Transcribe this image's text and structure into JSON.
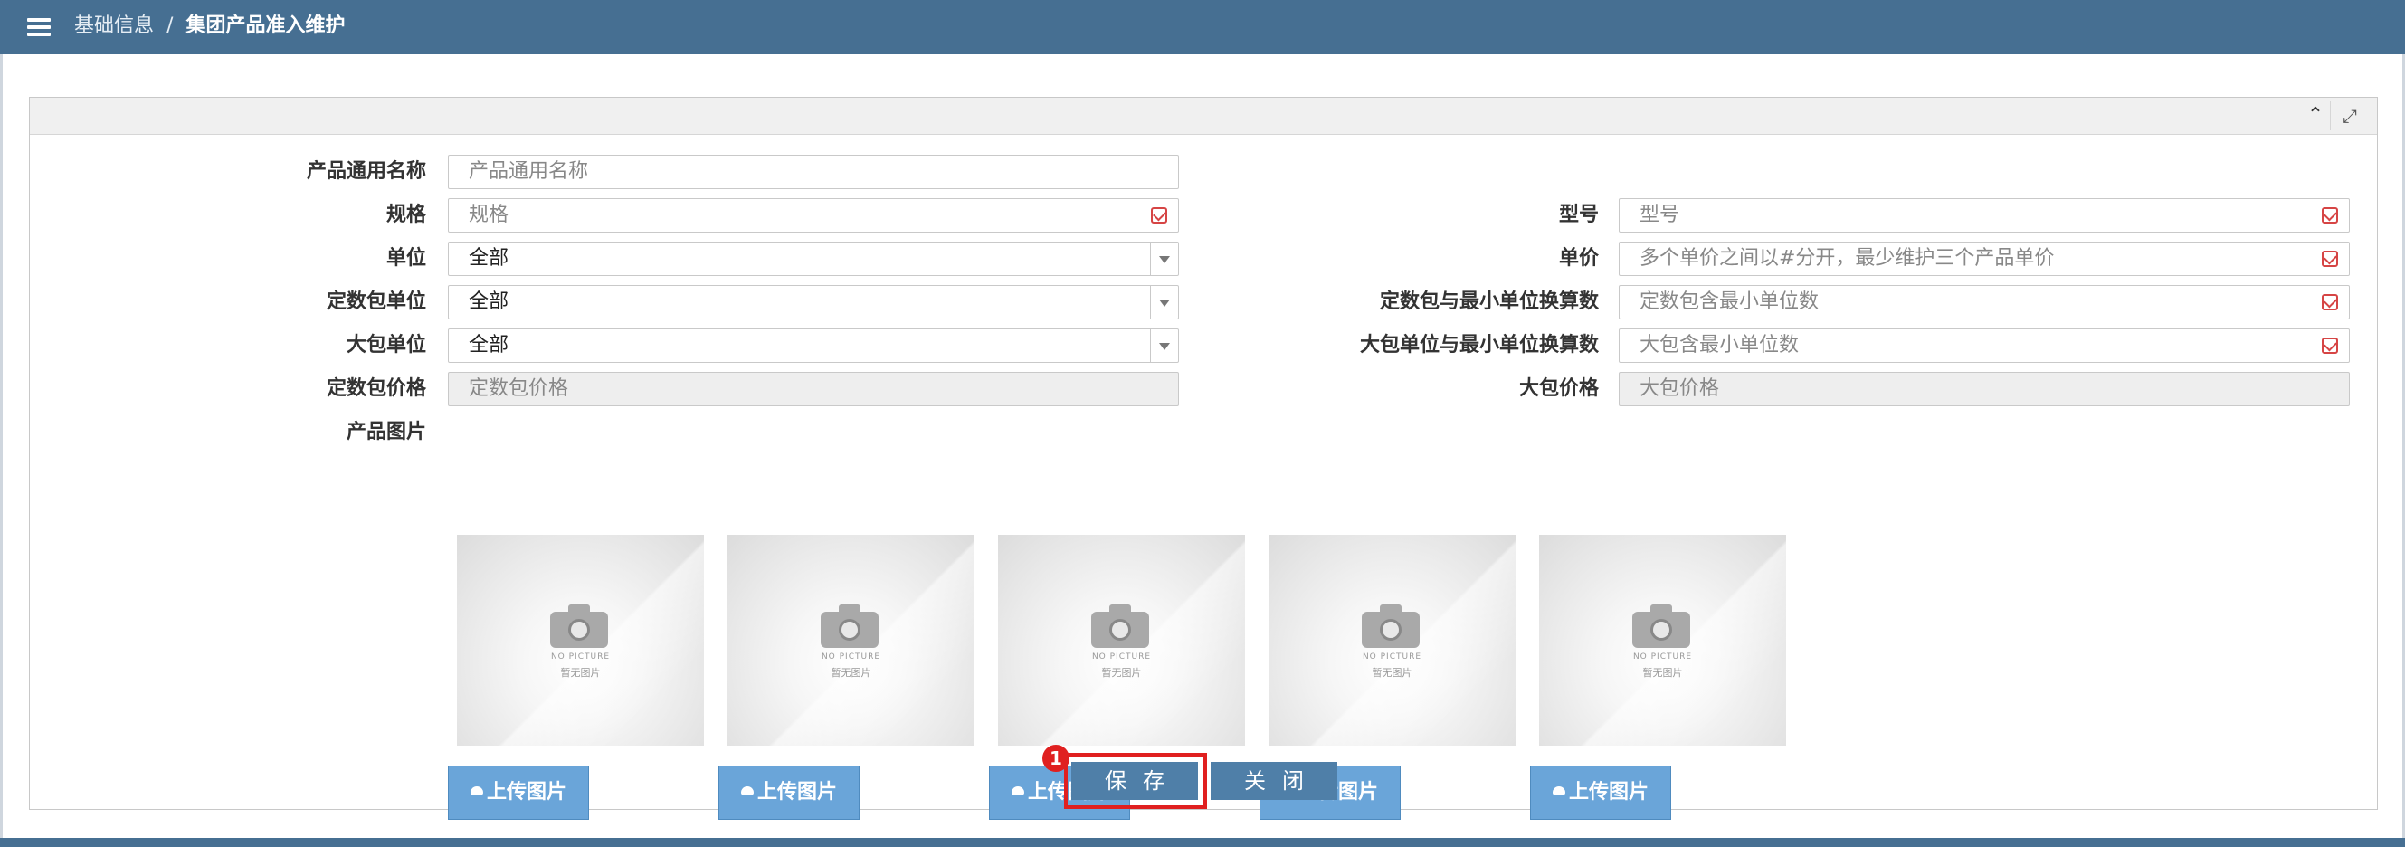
{
  "header": {
    "breadcrumb_parent": "基础信息",
    "breadcrumb_separator": "/",
    "breadcrumb_current": "集团产品准入维护",
    "bar_color": "#466f92"
  },
  "panel": {
    "collapse_icon": "chevron-up-icon",
    "expand_icon": "fullscreen-icon"
  },
  "form": {
    "generic_name": {
      "label": "产品通用名称",
      "placeholder": "产品通用名称"
    },
    "spec": {
      "label": "规格",
      "placeholder": "规格"
    },
    "model": {
      "label": "型号",
      "placeholder": "型号"
    },
    "unit": {
      "label": "单位",
      "value": "全部"
    },
    "unit_price": {
      "label": "单价",
      "placeholder": "多个单价之间以#分开，最少维护三个产品单价"
    },
    "pack_unit": {
      "label": "定数包单位",
      "value": "全部"
    },
    "pack_ratio": {
      "label": "定数包与最小单位换算数",
      "placeholder": "定数包含最小单位数"
    },
    "big_unit": {
      "label": "大包单位",
      "value": "全部"
    },
    "big_ratio": {
      "label": "大包单位与最小单位换算数",
      "placeholder": "大包含最小单位数"
    },
    "pack_price": {
      "label": "定数包价格",
      "placeholder": "定数包价格"
    },
    "big_price": {
      "label": "大包价格",
      "placeholder": "大包价格"
    },
    "pictures_label": "产品图片"
  },
  "pictures": [
    {
      "caption_en": "NO PICTURE",
      "caption_cn": "暂无图片",
      "upload_label": "上传图片"
    },
    {
      "caption_en": "NO PICTURE",
      "caption_cn": "暂无图片",
      "upload_label": "上传图片"
    },
    {
      "caption_en": "NO PICTURE",
      "caption_cn": "暂无图片",
      "upload_label": "上传图片"
    },
    {
      "caption_en": "NO PICTURE",
      "caption_cn": "暂无图片",
      "upload_label": "上传图片"
    },
    {
      "caption_en": "NO PICTURE",
      "caption_cn": "暂无图片",
      "upload_label": "上传图片"
    }
  ],
  "actions": {
    "save_label": "保存",
    "close_label": "关闭",
    "highlight_badge": "1",
    "highlight_color": "#e02020"
  }
}
